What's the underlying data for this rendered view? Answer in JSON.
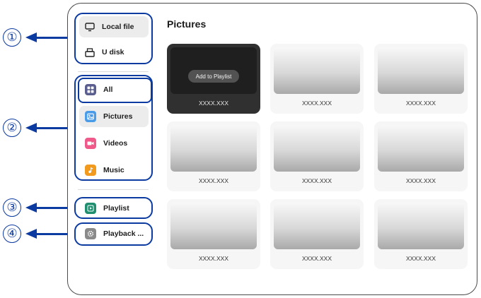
{
  "callouts": [
    "①",
    "②",
    "③",
    "④"
  ],
  "sidebar": {
    "sources": [
      {
        "label": "Local file",
        "icon": "monitor-icon"
      },
      {
        "label": "U disk",
        "icon": "usb-drive-icon"
      }
    ],
    "categories": [
      {
        "label": "All",
        "icon": "grid-icon",
        "color": "#5a5f8f"
      },
      {
        "label": "Pictures",
        "icon": "image-icon",
        "color": "#4a9be8"
      },
      {
        "label": "Videos",
        "icon": "video-camera-icon",
        "color": "#ef5a8a"
      },
      {
        "label": "Music",
        "icon": "music-note-icon",
        "color": "#f29a1e"
      }
    ],
    "playlist": {
      "label": "Playlist",
      "icon": "play-icon",
      "color": "#1f8f6f"
    },
    "settings": {
      "label": "Playback ...",
      "icon": "gear-icon",
      "color": "#8a8a8a"
    }
  },
  "main": {
    "title": "Pictures",
    "overlay_button": "Add to Playlist",
    "files": [
      "XXXX.XXX",
      "XXXX.XXX",
      "XXXX.XXX",
      "XXXX.XXX",
      "XXXX.XXX",
      "XXXX.XXX",
      "XXXX.XXX",
      "XXXX.XXX",
      "XXXX.XXX"
    ]
  },
  "colors": {
    "callout": "#0b3aa0",
    "selected_bg": "#ececec"
  }
}
